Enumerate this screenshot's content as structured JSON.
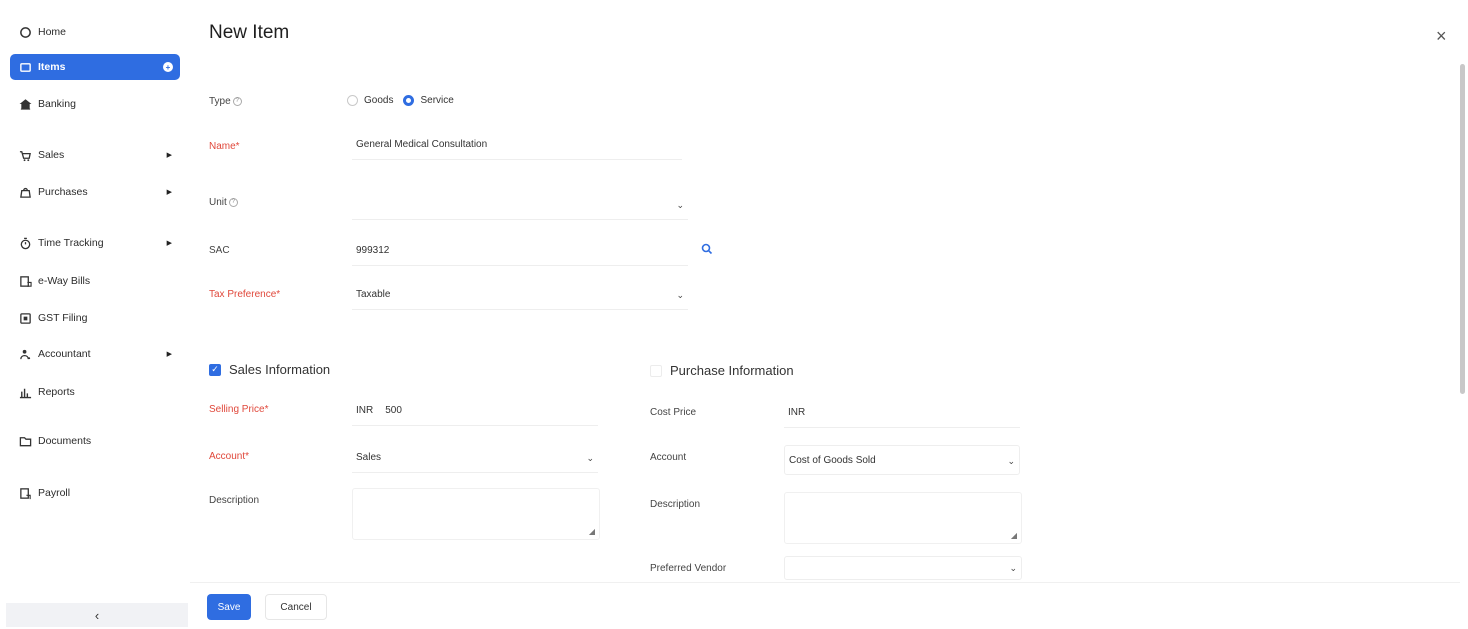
{
  "sidebar": {
    "items": [
      {
        "label": "Home",
        "icon": "home-icon"
      },
      {
        "label": "Items",
        "icon": "items-icon"
      },
      {
        "label": "Banking",
        "icon": "bank-icon"
      },
      {
        "label": "Sales",
        "icon": "cart-icon"
      },
      {
        "label": "Purchases",
        "icon": "bag-icon"
      },
      {
        "label": "Time Tracking",
        "icon": "timer-icon"
      },
      {
        "label": "e-Way Bills",
        "icon": "eway-icon"
      },
      {
        "label": "GST Filing",
        "icon": "gst-icon"
      },
      {
        "label": "Accountant",
        "icon": "accountant-icon"
      },
      {
        "label": "Reports",
        "icon": "reports-icon"
      },
      {
        "label": "Documents",
        "icon": "folder-icon"
      },
      {
        "label": "Payroll",
        "icon": "payroll-icon"
      }
    ],
    "collapse_glyph": "‹"
  },
  "page": {
    "title": "New Item",
    "close_glyph": "×"
  },
  "form": {
    "type_label": "Type",
    "type_options": [
      "Goods",
      "Service"
    ],
    "type_selected": "Service",
    "name_label": "Name*",
    "name_value": "General Medical Consultation",
    "unit_label": "Unit",
    "unit_value": "",
    "sac_label": "SAC",
    "sac_value": "999312",
    "tax_pref_label": "Tax Preference*",
    "tax_pref_value": "Taxable"
  },
  "sales": {
    "header": "Sales Information",
    "checked": true,
    "selling_price_label": "Selling Price*",
    "currency": "INR",
    "selling_price_value": "500",
    "account_label": "Account*",
    "account_value": "Sales",
    "description_label": "Description"
  },
  "purchase": {
    "header": "Purchase Information",
    "checked": false,
    "cost_price_label": "Cost Price",
    "currency": "INR",
    "account_label": "Account",
    "account_value": "Cost of Goods Sold",
    "description_label": "Description",
    "vendor_label": "Preferred Vendor"
  },
  "footer": {
    "save_label": "Save",
    "cancel_label": "Cancel"
  },
  "colors": {
    "accent": "#2f6de1",
    "required": "#e0483b"
  }
}
